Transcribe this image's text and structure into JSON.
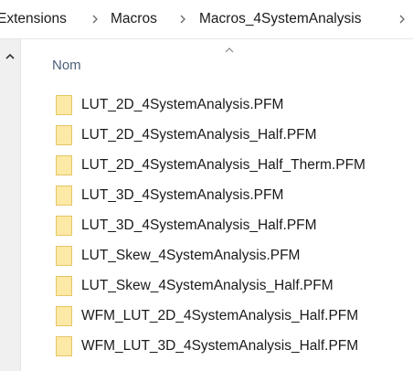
{
  "breadcrumb": {
    "items": [
      "Extensions",
      "Macros",
      "Macros_4SystemAnalysis"
    ],
    "separator_icon": "chevron-right-icon"
  },
  "column": {
    "header": "Nom",
    "sort_icon": "sort-ascending-icon"
  },
  "files": [
    "LUT_2D_4SystemAnalysis.PFM",
    "LUT_2D_4SystemAnalysis_Half.PFM",
    "LUT_2D_4SystemAnalysis_Half_Therm.PFM",
    "LUT_3D_4SystemAnalysis.PFM",
    "LUT_3D_4SystemAnalysis_Half.PFM",
    "LUT_Skew_4SystemAnalysis.PFM",
    "LUT_Skew_4SystemAnalysis_Half.PFM",
    "WFM_LUT_2D_4SystemAnalysis_Half.PFM",
    "WFM_LUT_3D_4SystemAnalysis_Half.PFM"
  ],
  "file_icon": "file-icon",
  "colors": {
    "file_icon_fill": "#fde9a6",
    "file_icon_stroke": "#e5c566",
    "header_text": "#4c607a"
  }
}
